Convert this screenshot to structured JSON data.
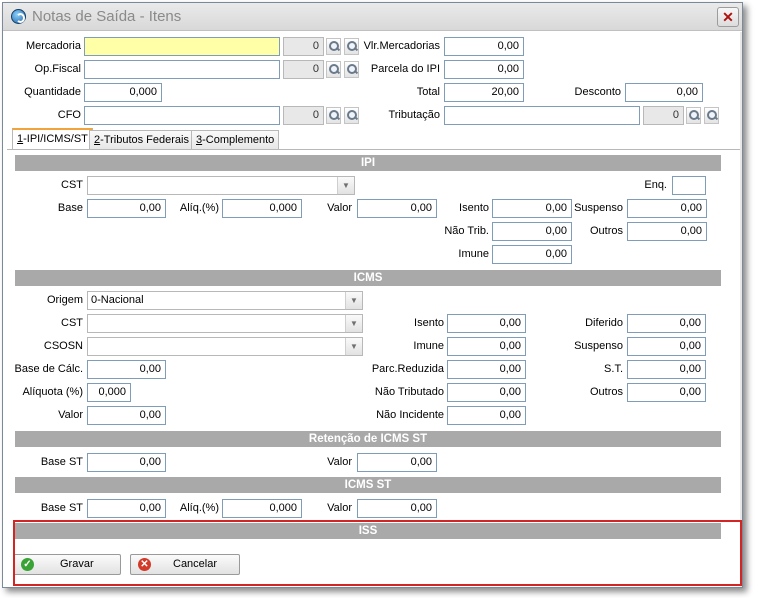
{
  "window": {
    "title": "Notas de Saída - Itens",
    "close_glyph": "✕"
  },
  "header": {
    "mercadoria": {
      "label": "Mercadoria",
      "value": "",
      "code": "0"
    },
    "op_fiscal": {
      "label": "Op.Fiscal",
      "value": "",
      "code": "0"
    },
    "quantidade": {
      "label": "Quantidade",
      "value": "0,000"
    },
    "cfo": {
      "label": "CFO",
      "value": "",
      "code": "0"
    },
    "vlr_mercadorias": {
      "label": "Vlr.Mercadorias",
      "value": "0,00"
    },
    "parcela_ipi": {
      "label": "Parcela do IPI",
      "value": "0,00"
    },
    "total": {
      "label": "Total",
      "value": "20,00"
    },
    "desconto": {
      "label": "Desconto",
      "value": "0,00"
    },
    "tributacao": {
      "label": "Tributação",
      "value": "",
      "code": "0"
    }
  },
  "tabs": [
    {
      "key": "1",
      "rest": "-IPI/ICMS/ST",
      "active": true
    },
    {
      "key": "2",
      "rest": "-Tributos Federais",
      "active": false
    },
    {
      "key": "3",
      "rest": "-Complemento",
      "active": false
    }
  ],
  "ipi": {
    "title": "IPI",
    "cst": {
      "label": "CST",
      "value": ""
    },
    "enq": {
      "label": "Enq.",
      "value": ""
    },
    "base": {
      "label": "Base",
      "value": "0,00"
    },
    "aliq": {
      "label": "Alíq.(%)",
      "value": "0,000"
    },
    "valor": {
      "label": "Valor",
      "value": "0,00"
    },
    "isento": {
      "label": "Isento",
      "value": "0,00"
    },
    "suspenso": {
      "label": "Suspenso",
      "value": "0,00"
    },
    "nao_trib": {
      "label": "Não Trib.",
      "value": "0,00"
    },
    "outros": {
      "label": "Outros",
      "value": "0,00"
    },
    "imune": {
      "label": "Imune",
      "value": "0,00"
    }
  },
  "icms": {
    "title": "ICMS",
    "origem": {
      "label": "Origem",
      "value": "0-Nacional"
    },
    "cst": {
      "label": "CST",
      "value": ""
    },
    "csosn": {
      "label": "CSOSN",
      "value": ""
    },
    "base_calc": {
      "label": "Base de Cálc.",
      "value": "0,00"
    },
    "aliquota": {
      "label": "Alíquota (%)",
      "value": "0,000"
    },
    "valor": {
      "label": "Valor",
      "value": "0,00"
    },
    "isento": {
      "label": "Isento",
      "value": "0,00"
    },
    "imune": {
      "label": "Imune",
      "value": "0,00"
    },
    "parc_reduzida": {
      "label": "Parc.Reduzida",
      "value": "0,00"
    },
    "nao_tributado": {
      "label": "Não Tributado",
      "value": "0,00"
    },
    "nao_incidente": {
      "label": "Não Incidente",
      "value": "0,00"
    },
    "diferido": {
      "label": "Diferido",
      "value": "0,00"
    },
    "suspenso": {
      "label": "Suspenso",
      "value": "0,00"
    },
    "st": {
      "label": "S.T.",
      "value": "0,00"
    },
    "outros": {
      "label": "Outros",
      "value": "0,00"
    }
  },
  "retencao_st": {
    "title": "Retenção de ICMS ST",
    "base_st": {
      "label": "Base ST",
      "value": "0,00"
    },
    "valor": {
      "label": "Valor",
      "value": "0,00"
    }
  },
  "icms_st": {
    "title": "ICMS ST",
    "base_st": {
      "label": "Base ST",
      "value": "0,00"
    },
    "aliq": {
      "label": "Alíq.(%)",
      "value": "0,000"
    },
    "valor": {
      "label": "Valor",
      "value": "0,00"
    }
  },
  "iss": {
    "title": "ISS"
  },
  "buttons": {
    "gravar": "Gravar",
    "cancelar": "Cancelar"
  },
  "colors": {
    "section_header": "#a9a9a9",
    "required_field": "#ffffa8",
    "highlight_border": "#d42525"
  }
}
